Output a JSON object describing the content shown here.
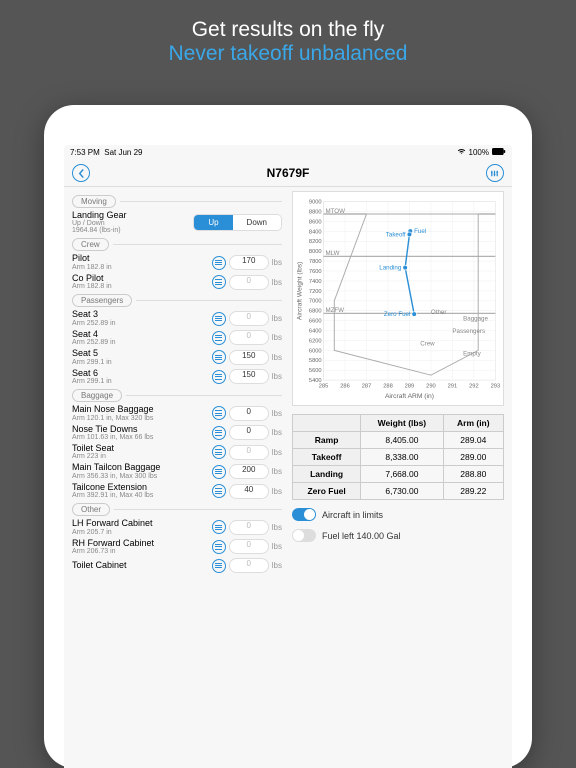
{
  "hero": {
    "line1": "Get results on the fly",
    "line2": "Never takeoff unbalanced"
  },
  "status": {
    "time": "7:53 PM",
    "date": "Sat Jun 29",
    "battery": "100%"
  },
  "nav": {
    "title": "N7679F"
  },
  "sections": {
    "moving": "Moving",
    "crew": "Crew",
    "passengers": "Passengers",
    "baggage": "Baggage",
    "other": "Other"
  },
  "moving": {
    "gear": {
      "name": "Landing Gear",
      "sub": "Up / Down",
      "sub2": "1964.84 (lbs-in)",
      "up": "Up",
      "down": "Down"
    }
  },
  "crew": [
    {
      "name": "Pilot",
      "sub": "Arm 182.8 in",
      "val": "170",
      "unit": "lbs"
    },
    {
      "name": "Co Pilot",
      "sub": "Arm 182.8 in",
      "val": "",
      "ph": "0",
      "unit": "lbs"
    }
  ],
  "passengers": [
    {
      "name": "Seat 3",
      "sub": "Arm 252.89 in",
      "val": "",
      "ph": "0",
      "unit": "lbs"
    },
    {
      "name": "Seat 4",
      "sub": "Arm 252.89 in",
      "val": "",
      "ph": "0",
      "unit": "lbs"
    },
    {
      "name": "Seat 5",
      "sub": "Arm 299.1 in",
      "val": "150",
      "unit": "lbs"
    },
    {
      "name": "Seat 6",
      "sub": "Arm 299.1 in",
      "val": "150",
      "unit": "lbs"
    }
  ],
  "baggage": [
    {
      "name": "Main Nose Baggage",
      "sub": "Arm 120.1 in, Max 320 lbs",
      "val": "0",
      "unit": "lbs"
    },
    {
      "name": "Nose Tie Downs",
      "sub": "Arm 101.63 in, Max 66 lbs",
      "val": "0",
      "unit": "lbs"
    },
    {
      "name": "Toilet Seat",
      "sub": "Arm 223 in",
      "val": "",
      "ph": "0",
      "unit": "lbs"
    },
    {
      "name": "Main Tailcon Baggage",
      "sub": "Arm 356.33 in, Max 300 lbs",
      "val": "200",
      "unit": "lbs"
    },
    {
      "name": "Tailcone Extension",
      "sub": "Arm 392.91 in, Max 40 lbs",
      "val": "40",
      "unit": "lbs"
    }
  ],
  "other": [
    {
      "name": "LH Forward Cabinet",
      "sub": "Arm 205.7 in",
      "val": "",
      "ph": "0",
      "unit": "lbs"
    },
    {
      "name": "RH Forward Cabinet",
      "sub": "Arm 206.73 in",
      "val": "",
      "ph": "0",
      "unit": "lbs"
    },
    {
      "name": "Toilet Cabinet",
      "sub": "",
      "val": "",
      "ph": "0",
      "unit": "lbs"
    }
  ],
  "table": {
    "h1": "Weight (lbs)",
    "h2": "Arm (in)",
    "rows": [
      {
        "k": "Ramp",
        "w": "8,405.00",
        "a": "289.04"
      },
      {
        "k": "Takeoff",
        "w": "8,338.00",
        "a": "289.00"
      },
      {
        "k": "Landing",
        "w": "7,668.00",
        "a": "288.80"
      },
      {
        "k": "Zero Fuel",
        "w": "6,730.00",
        "a": "289.22"
      }
    ]
  },
  "limits": {
    "t1": "Aircraft in limits",
    "t2": "Fuel left 140.00 Gal"
  },
  "chart_data": {
    "type": "line",
    "xlabel": "Aircraft ARM (in)",
    "ylabel": "Aircraft Weight (lbs)",
    "xlim": [
      285,
      293
    ],
    "ylim": [
      5400,
      9000
    ],
    "xticks": [
      285,
      286,
      287,
      288,
      289,
      290,
      291,
      292,
      293
    ],
    "yticks": [
      5400,
      5600,
      5800,
      6000,
      6200,
      6400,
      6600,
      6800,
      7000,
      7200,
      7400,
      7600,
      7800,
      8000,
      8200,
      8400,
      8600,
      8800,
      9000
    ],
    "hlines": [
      {
        "label": "MTOW",
        "y": 8750
      },
      {
        "label": "MLW",
        "y": 7900
      },
      {
        "label": "MZFW",
        "y": 6750
      }
    ],
    "series": [
      {
        "name": "flight",
        "points": [
          {
            "label": "Fuel",
            "x": 289.04,
            "y": 8405
          },
          {
            "label": "Takeoff",
            "x": 289.0,
            "y": 8338
          },
          {
            "label": "Landing",
            "x": 288.8,
            "y": 7668
          },
          {
            "label": "Zero Fuel",
            "x": 289.22,
            "y": 6730
          }
        ]
      }
    ],
    "annotations": [
      "Other",
      "Baggage",
      "Passengers",
      "Crew",
      "Empty"
    ]
  }
}
